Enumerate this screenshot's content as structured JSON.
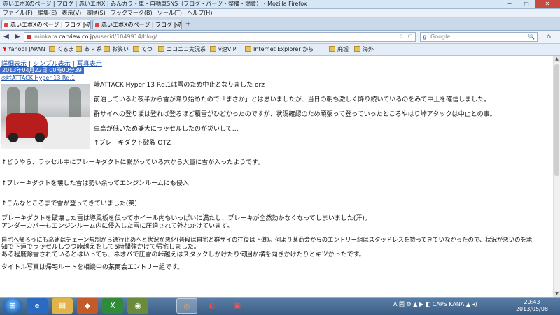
{
  "window": {
    "title": "赤いエボXのページ | ブログ | 赤いエボX | みんカラ - 車・自動車SNS（ブログ・パーツ・整備・燃費） - Mozilla Firefox",
    "min_label": "─",
    "max_label": "□",
    "close_label": "✕"
  },
  "menu": [
    "ファイル(F)",
    "編集(E)",
    "表示(V)",
    "履歴(S)",
    "ブックマーク(B)",
    "ツール(T)",
    "ヘルプ(H)"
  ],
  "tabs": [
    {
      "label": "赤いエボXのページ | ブログ | 赤いエ..."
    },
    {
      "label": "赤いエボXのページ | ブログ | 赤いエ..."
    }
  ],
  "newtab_label": "+",
  "nav": {
    "back": "◀",
    "forward": "▶",
    "url_prefix": "minkara.",
    "url_host": "carview.co.jp",
    "url_path": "/userid/1049914/blog/",
    "star": "☆",
    "reload": "C",
    "search_placeholder": "Google",
    "search_engine_glyph": "g",
    "search_glyph": "🔍",
    "home": "⌂"
  },
  "bookmarks": [
    {
      "label": "Yahoo! JAPAN",
      "type": "yahoo"
    },
    {
      "label": "くるま",
      "type": "folder"
    },
    {
      "label": "あ P 系",
      "type": "folder"
    },
    {
      "label": "お笑い",
      "type": "folder"
    },
    {
      "label": "てつ",
      "type": "folder"
    },
    {
      "label": "ニコニコ実況系",
      "type": "folder"
    },
    {
      "label": "v速VIP",
      "type": "folder"
    },
    {
      "label": "Internet Explorer から",
      "type": "folder"
    },
    {
      "label": "廃墟",
      "type": "folder"
    },
    {
      "label": "海外",
      "type": "folder"
    }
  ],
  "page": {
    "view_links": [
      "詳細表示",
      "シンプル表示",
      "写真表示"
    ],
    "link_separator": "|",
    "date": "2013年04月22日 00時00分39",
    "post_title": "◎峠ATTACK Hyper 13 Rd.1",
    "paragraphs": [
      "峠ATTACK Hyper 13 Rd.1は雪のため中止となりました orz",
      "前泊していると夜半から雪が降り始めたので「まさか」とは思いましたが、当日の朝も激しく降り続いているのをみて中止を確信しました。",
      "群サイへの登り坂は登れば登るほど積雪がひどかったのですが、状況確認のため頑張って登っていったところやはり峠アタックは中止との事。",
      "車高が低いため盛大にラッセルしたのが災いして…",
      "↑ブレーキダクト破裂 OTZ",
      "↑どうやら、ラッセル中にブレーキダクトに繋がっている穴から大量に雪が入ったようです。",
      "↑ブレーキダクトを壊した雪は勢い余ってエンジンルームにも侵入",
      "↑こんなところまで雪が登ってきていました(笑)",
      "ブレーキダクトを破壊した雪は導風板を伝ってホイール内もいっぱいに満たし、ブレーキが全然効かなくなってしまいました(汗)。",
      "アンダーカバーもエンジンルーム内に侵入した雪に圧迫されて外れかけています。",
      "自宅へ帰ろうにも高速はチェーン規制から通行止めへと状況が悪化(普段は自宅と群サイの往復は下道)。何より某商会からのエントリー組はスタッドレスを持ってきていなかったので、状況が悪いのを承",
      "知で下道でラッセルしつつ峠越えをして5時間強かけて帰宅しました。",
      "ある程度除雪されているとはいっても、ネオバで圧雪の峠越えはスタックしかけたり何回か横を向きかけたりとキツかったです。",
      "タイトル写真は帰宅ルートを相談中の某商会エントリー組です。"
    ]
  },
  "taskbar": {
    "start_glyph": "⊞",
    "apps": [
      "e",
      "▤",
      "◆",
      "X",
      "◉",
      "◎",
      "◐",
      "▣"
    ],
    "tray_text": "A 囲 ⚙ ▲ ▶ ◧ CAPS KANA ▲ ◂)",
    "time": "20:43",
    "date": "2013/05/08"
  }
}
